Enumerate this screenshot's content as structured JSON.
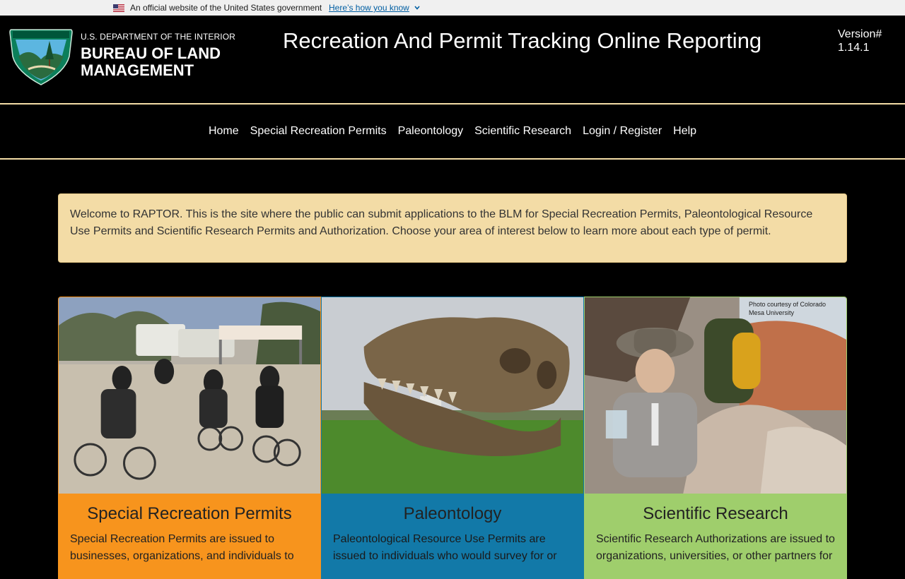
{
  "gov_banner": {
    "official_text": "An official website of the United States government",
    "how_you_know": "Here’s how you know"
  },
  "header": {
    "department": "U.S. DEPARTMENT OF THE INTERIOR",
    "bureau": "BUREAU OF LAND MANAGEMENT",
    "site_title": "Recreation And Permit Tracking Online Reporting",
    "version_label": "Version#",
    "version_number": "1.14.1"
  },
  "nav": {
    "items": [
      {
        "label": "Home"
      },
      {
        "label": "Special Recreation Permits"
      },
      {
        "label": "Paleontology"
      },
      {
        "label": "Scientific Research"
      },
      {
        "label": "Login / Register"
      },
      {
        "label": "Help"
      }
    ]
  },
  "welcome_text": "Welcome to RAPTOR. This is the site where the public can submit applications to the BLM for Special Recreation Permits, Paleontological Resource Use Permits and Scientific Research Permits and Authorization. Choose your area of interest below to learn more about each type of permit.",
  "cards": [
    {
      "title": "Special Recreation Permits",
      "text": "Special Recreation Permits are issued to businesses, organizations, and individuals to"
    },
    {
      "title": "Paleontology",
      "text": "Paleontological Resource Use Permits are issued to individuals who would survey for or"
    },
    {
      "title": "Scientific Research",
      "text": "Scientific Research Authorizations are issued to organizations, universities, or other partners for",
      "photo_credit": "Photo courtesy of Colorado Mesa University"
    }
  ],
  "colors": {
    "header_bg": "#000000",
    "accent_gold": "#f3dca6",
    "card_orange": "#f7941d",
    "card_blue": "#1279a8",
    "card_green": "#9fce6c"
  },
  "icons": [
    "us-flag-icon",
    "chevron-down-icon",
    "blm-logo-icon"
  ]
}
